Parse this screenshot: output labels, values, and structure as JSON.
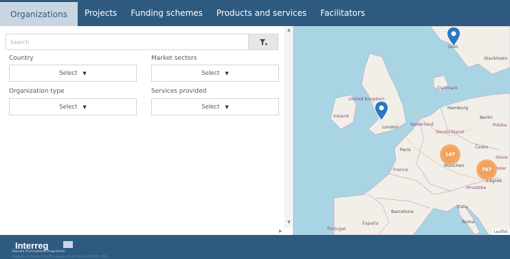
{
  "nav": {
    "tabs": [
      {
        "label": "Organizations",
        "active": true
      },
      {
        "label": "Projects",
        "active": false
      },
      {
        "label": "Funding schemes",
        "active": false
      },
      {
        "label": "Products and services",
        "active": false
      },
      {
        "label": "Facilitators",
        "active": false
      }
    ]
  },
  "filters": {
    "search_placeholder": "Search",
    "filter_icon": "filter-icon",
    "country": {
      "label": "Country",
      "value": "Select"
    },
    "market_sectors": {
      "label": "Market sectors",
      "value": "Select"
    },
    "organization_type": {
      "label": "Organization type",
      "value": "Select"
    },
    "services_provided": {
      "label": "Services provided",
      "value": "Select"
    }
  },
  "map": {
    "labels": {
      "oslo": "Oslo",
      "stockholm": "Stockholm",
      "united_kingdom": "United Kingdom",
      "ireland": "Ireland",
      "london": "London",
      "danmark": "Danmark",
      "hamburg": "Hamburg",
      "berlin": "Berlin",
      "nederland": "Nederland",
      "polska": "Polska",
      "deutschland": "Deutschland",
      "paris": "Paris",
      "cesko": "Česko",
      "munchen": "München",
      "slovensko": "Slove",
      "france": "France",
      "osterreich": "Öster",
      "zagreb": "Zagreb",
      "hrvatska": "Hrvatska",
      "italia": "Italia",
      "barcelona": "Barcelona",
      "espana": "España",
      "portugal": "Portugal",
      "roma": "Roma"
    },
    "clusters": [
      {
        "name": "cluster-germany",
        "count": "147"
      },
      {
        "name": "cluster-austria",
        "count": "767"
      }
    ],
    "attribution": "Leaflet",
    "colors": {
      "water": "#a9d4e3",
      "land": "#f2efe9",
      "cluster": "#f0a35e",
      "pin": "#2a78c4"
    }
  },
  "footer": {
    "logo": "Interreg",
    "programme": "Danube Transnational Programme",
    "note": "Project co-funded by European Union funds (ERDF, IPA)"
  }
}
